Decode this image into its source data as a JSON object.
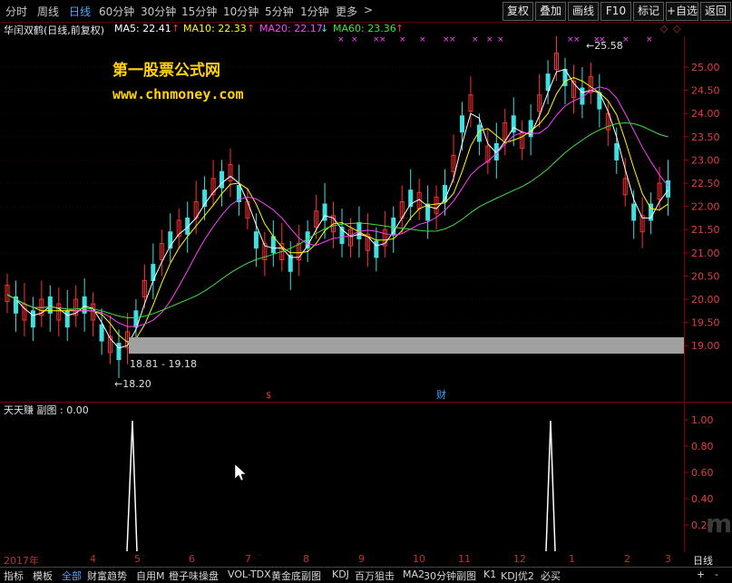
{
  "period_bar": {
    "items": [
      "分时",
      "周线",
      "日线",
      "60分钟",
      "30分钟",
      "15分钟",
      "10分钟",
      "5分钟",
      "1分钟",
      "更多"
    ],
    "active": "日线",
    "more_arrow": ">"
  },
  "toolbar": {
    "buttons": [
      "复权",
      "叠加",
      "画线",
      "F10",
      "标记",
      "+自选",
      "返回"
    ]
  },
  "info": {
    "stock_name": "华闰双鹤(日线,前复权)",
    "ma5": "MA5: 22.41",
    "ma10": "MA10: 22.33",
    "ma20": "MA20: 22.17",
    "ma60": "MA60: 23.36",
    "ma5_arrow": "↑",
    "ma10_arrow": "↑",
    "ma20_arrow": "↓",
    "ma60_arrow": "↑",
    "colors": {
      "ma5": "#ffffff",
      "ma10": "#ffff00",
      "ma20": "#ff40ff",
      "ma60": "#40e040",
      "up": "#ff3030",
      "down": "#40e0e0"
    }
  },
  "watermark": {
    "line1": "第一股票公式网",
    "line2": "www.chnmoney.com"
  },
  "main_chart": {
    "price_ticks": [
      "25.00",
      "24.50",
      "24.00",
      "23.50",
      "23.00",
      "22.50",
      "22.00",
      "21.50",
      "21.00",
      "20.50",
      "20.00",
      "19.50",
      "19.00"
    ],
    "high_label": "25.58",
    "low_label": "18.20",
    "band_label": "18.81 - 19.18",
    "event_marks": [
      "$",
      "财"
    ]
  },
  "sub_chart": {
    "title": "天天赚 副图 : 0.00",
    "ticks": [
      "1.00",
      "0.80",
      "0.60",
      "0.40",
      "0.20"
    ]
  },
  "time_axis": {
    "labels": [
      "2017年",
      "4",
      "5",
      "6",
      "7",
      "8",
      "9",
      "10",
      "11",
      "12",
      "1",
      "2",
      "3"
    ],
    "period_label": "日线",
    "zoom_plus": "+",
    "zoom_minus": "-"
  },
  "bottom_tabs": {
    "items": [
      "指标",
      "模板",
      "全部",
      "财富趋势",
      "自用M",
      "橙子味操盘",
      "VOL-TDX",
      "黄金底副图",
      "KDJ",
      "百万狙击",
      "MA2",
      "30分钟副图",
      "K1",
      "KDJ优2",
      "必买"
    ],
    "active": "全部"
  }
}
